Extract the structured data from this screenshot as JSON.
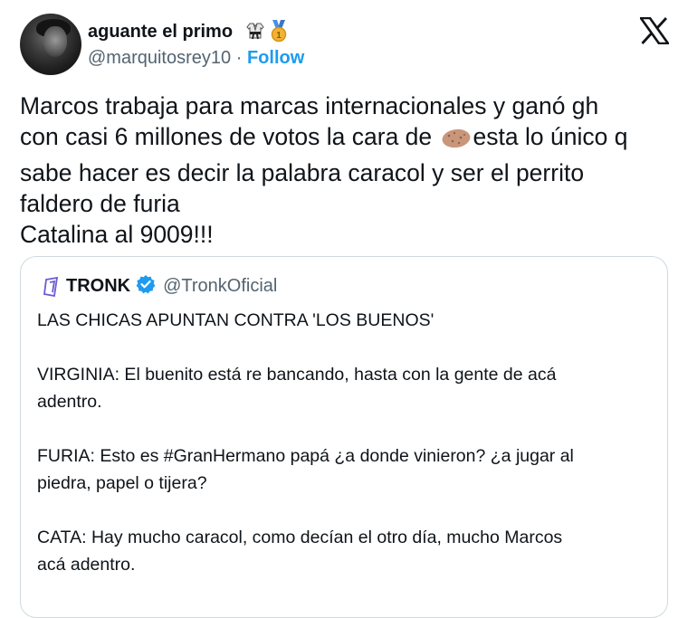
{
  "author": {
    "display_name": "aguante el primo",
    "handle": "@marquitosrey10",
    "separator": "·",
    "follow_label": "Follow",
    "badges": [
      "martial-arts-uniform-icon",
      "medal-icon"
    ],
    "medal_number": "1"
  },
  "brand": {
    "logo": "x-logo-icon"
  },
  "tweet": {
    "line1": "Marcos trabaja para marcas internacionales y ganó gh",
    "line2_a": "con casi 6 millones de votos la cara de",
    "line2_b": "esta lo único q",
    "line3": "sabe hacer es decir la palabra caracol y ser el perrito",
    "line4": "faldero de furia",
    "line5": "Catalina al 9009!!!",
    "emoji": "potato-icon"
  },
  "quoted": {
    "name": "TRONK",
    "handle": "@TronkOficial",
    "verified": true,
    "lines": {
      "l1": "LAS CHICAS APUNTAN CONTRA 'LOS BUENOS'",
      "l2": "VIRGINIA: El buenito está re bancando, hasta con la gente de acá",
      "l3": "adentro.",
      "l4": "FURIA: Esto es #GranHermano papá ¿a donde vinieron? ¿a jugar al",
      "l5": "piedra, papel o tijera?",
      "l6": "CATA: Hay mucho caracol, como decían el otro día, mucho Marcos",
      "l7": "acá adentro."
    }
  },
  "colors": {
    "text": "#0f1419",
    "muted": "#536471",
    "link": "#1d9bf0",
    "border": "#cfd9de"
  }
}
